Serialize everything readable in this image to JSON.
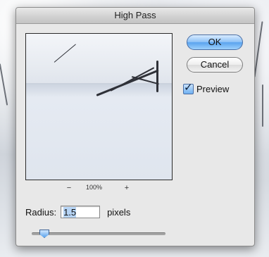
{
  "dialog": {
    "title": "High Pass"
  },
  "preview": {
    "zoom_out_symbol": "−",
    "zoom_level": "100%",
    "zoom_in_symbol": "+"
  },
  "buttons": {
    "ok_label": "OK",
    "cancel_label": "Cancel"
  },
  "options": {
    "preview_label": "Preview",
    "preview_checked": true,
    "check_symbol": "✓"
  },
  "radius": {
    "label": "Radius:",
    "value": "1.5",
    "unit": "pixels",
    "slider_fraction": 0.06
  },
  "colors": {
    "accent": "#5aa3ee"
  }
}
